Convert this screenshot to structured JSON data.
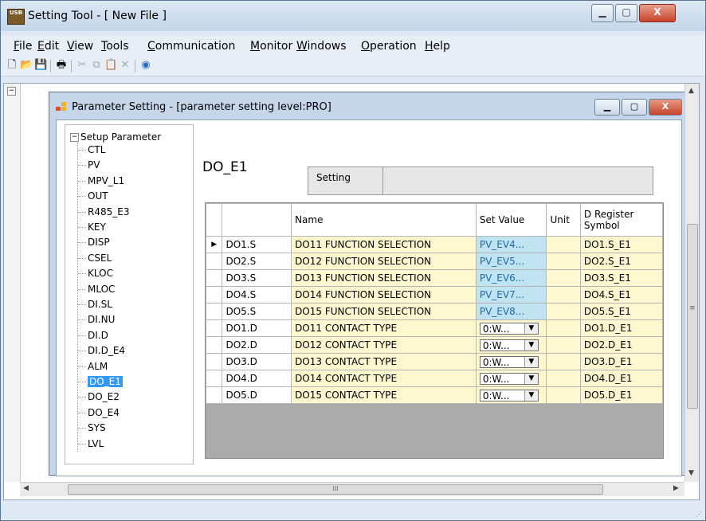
{
  "window": {
    "title": "Setting Tool - [ New File ]",
    "icon_text": "USB"
  },
  "menu": {
    "items": [
      {
        "ul": "F",
        "rest": "ile"
      },
      {
        "ul": "E",
        "rest": "dit"
      },
      {
        "ul": "V",
        "rest": "iew"
      },
      {
        "ul": "T",
        "rest": "ools"
      },
      {
        "ul": "C",
        "rest": "ommunication"
      },
      {
        "ul": "M",
        "rest": "onitor"
      },
      {
        "ul": "W",
        "rest": "indows"
      },
      {
        "ul": "O",
        "rest": "peration"
      },
      {
        "ul": "H",
        "rest": "elp"
      }
    ]
  },
  "toolbar_icons": [
    "new-file-icon",
    "open-folder-icon",
    "save-icon",
    "print-icon",
    "cut-icon",
    "copy-icon",
    "paste-icon",
    "delete-icon",
    "connect-icon"
  ],
  "child": {
    "title": "Parameter Setting - [parameter setting level:PRO]"
  },
  "tree": {
    "root": "Setup Parameter",
    "items": [
      "CTL",
      "PV",
      "MPV_L1",
      "OUT",
      "R485_E3",
      "KEY",
      "DISP",
      "CSEL",
      "KLOC",
      "MLOC",
      "DI.SL",
      "DI.NU",
      "DI.D",
      "DI.D_E4",
      "ALM",
      "DO_E1",
      "DO_E2",
      "DO_E4",
      "SYS",
      "LVL"
    ],
    "selected": "DO_E1"
  },
  "block": {
    "title": "DO_E1",
    "setting_label": "Setting",
    "setting_value": ""
  },
  "grid": {
    "headers": {
      "name": "Name",
      "set_value": "Set Value",
      "unit": "Unit",
      "symbol_line1": "D Register",
      "symbol_line2": "Symbol"
    },
    "current_row_marker": "▶",
    "rows": [
      {
        "key": "DO1.S",
        "name": "DO11 FUNCTION SELECTION",
        "value": "PV_EV4...",
        "combo": false,
        "unit": "",
        "symbol": "DO1.S_E1"
      },
      {
        "key": "DO2.S",
        "name": "DO12 FUNCTION SELECTION",
        "value": "PV_EV5...",
        "combo": false,
        "unit": "",
        "symbol": "DO2.S_E1"
      },
      {
        "key": "DO3.S",
        "name": "DO13 FUNCTION SELECTION",
        "value": "PV_EV6...",
        "combo": false,
        "unit": "",
        "symbol": "DO3.S_E1"
      },
      {
        "key": "DO4.S",
        "name": "DO14 FUNCTION SELECTION",
        "value": "PV_EV7...",
        "combo": false,
        "unit": "",
        "symbol": "DO4.S_E1"
      },
      {
        "key": "DO5.S",
        "name": "DO15 FUNCTION SELECTION",
        "value": "PV_EV8...",
        "combo": false,
        "unit": "",
        "symbol": "DO5.S_E1"
      },
      {
        "key": "DO1.D",
        "name": "DO11 CONTACT TYPE",
        "value": "0:W...",
        "combo": true,
        "unit": "",
        "symbol": "DO1.D_E1"
      },
      {
        "key": "DO2.D",
        "name": "DO12 CONTACT TYPE",
        "value": "0:W...",
        "combo": true,
        "unit": "",
        "symbol": "DO2.D_E1"
      },
      {
        "key": "DO3.D",
        "name": "DO13 CONTACT TYPE",
        "value": "0:W...",
        "combo": true,
        "unit": "",
        "symbol": "DO3.D_E1"
      },
      {
        "key": "DO4.D",
        "name": "DO14 CONTACT TYPE",
        "value": "0:W...",
        "combo": true,
        "unit": "",
        "symbol": "DO4.D_E1"
      },
      {
        "key": "DO5.D",
        "name": "DO15 CONTACT TYPE",
        "value": "0:W...",
        "combo": true,
        "unit": "",
        "symbol": "DO5.D_E1"
      }
    ]
  },
  "scroll": {
    "h_thumb_grip": "III"
  }
}
